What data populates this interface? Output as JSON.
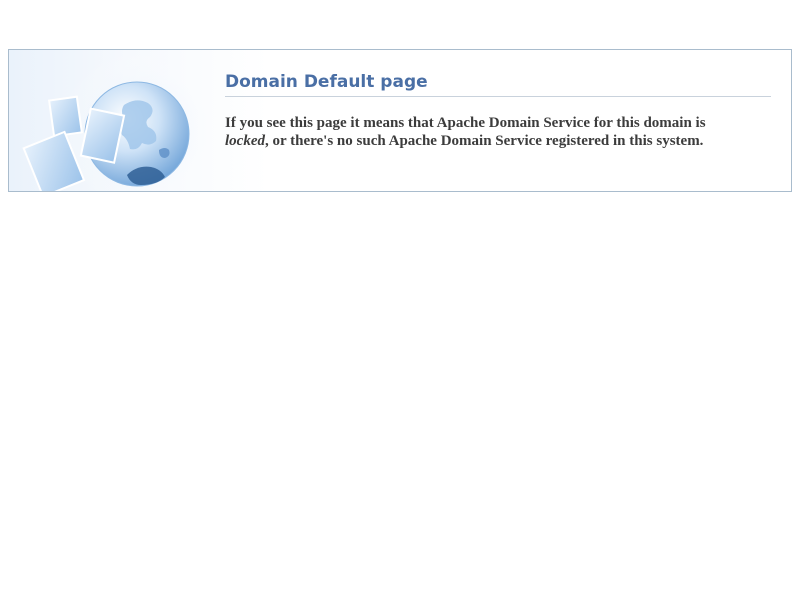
{
  "panel": {
    "title": "Domain Default page",
    "message": {
      "part1": "If you see this page it means that Apache Domain Service for this domain is",
      "emphasis": "locked",
      "part2": ", or there's no such Apache Domain Service registered in this system."
    },
    "icon": "globe-with-documents-icon"
  },
  "colors": {
    "title": "#4a6fa5",
    "border": "#a9bccd",
    "text": "#3c3c3c"
  }
}
